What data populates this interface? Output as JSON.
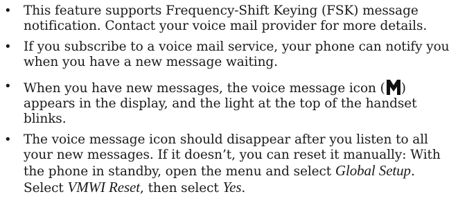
{
  "bullets": [
    {
      "lines": [
        "This feature supports Frequency-Shift Keying (FSK) message",
        "notification. Contact your voice mail provider for more details."
      ]
    },
    {
      "lines": [
        "If you subscribe to a voice mail service, your phone can notify you",
        "when you have a new message waiting."
      ]
    },
    {
      "line1_before_icon": "When you have new messages, the voice message icon (",
      "line1_after_icon": ")",
      "icon": "voice-message-icon",
      "lines_rest": [
        "appears in the display, and the light at the top of the handset",
        "blinks."
      ]
    },
    {
      "lines": [
        "The voice message icon should disappear after you listen to all",
        "your new messages. If it doesn’t, you can reset it manually: With"
      ],
      "line3_before": "the phone in standby, open the menu and select ",
      "line3_emph": "Global Setup",
      "line3_after": ".",
      "line4_before": "Select ",
      "line4_emph1": "VMWI Reset",
      "line4_mid": ", then select ",
      "line4_emph2": "Yes",
      "line4_after": "."
    }
  ],
  "bullet_glyph": "•"
}
